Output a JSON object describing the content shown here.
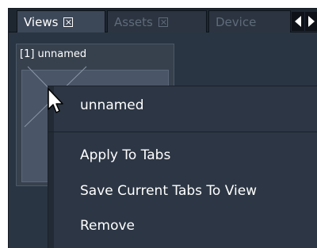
{
  "tabs": [
    {
      "label": "Views",
      "active": true
    },
    {
      "label": "Assets",
      "active": false
    },
    {
      "label": "Device",
      "active": false
    }
  ],
  "view_thumbnail": {
    "label": "[1] unnamed"
  },
  "context_menu": {
    "header": "unnamed",
    "items": [
      "Apply To Tabs",
      "Save Current Tabs To View",
      "Remove"
    ]
  },
  "colors": {
    "panel_bg": "#2a3543",
    "tab_active": "#3c4757",
    "menu_bg": "#2c3644",
    "text": "#ffffff",
    "text_disabled": "#5f6b7a"
  },
  "icons": [
    "close-icon",
    "scroll-left-icon",
    "scroll-right-icon",
    "mouse-pointer-icon"
  ]
}
